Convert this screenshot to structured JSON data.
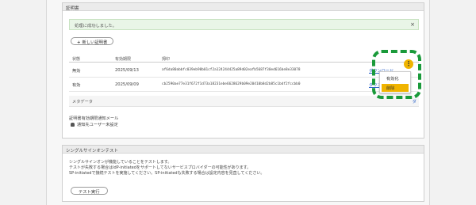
{
  "certificates": {
    "panel_title": "証明書",
    "alert_message": "処理に成功しました。",
    "alert_close": "×",
    "new_cert_button": "新しい証明書",
    "new_cert_plus": "+",
    "columns": [
      "状態",
      "有効期限",
      "拇印"
    ],
    "rows": [
      {
        "status": "無効",
        "expiry": "2025/09/13",
        "thumbprint": "af6da80abbfc039eb90b01cf2a124244425a89d02eafb5687f30ed616be8e33078",
        "action": "ダウンロード"
      },
      {
        "status": "有効",
        "expiry": "2025/09/09",
        "thumbprint": "cb2590ae77e31f672f1d73a18231ebe6628629b09e20410b8d2b85c1bdf2fccbb0",
        "action": "ダウンロード"
      }
    ],
    "menu_icon": "⋮",
    "menu_items": [
      "有効化",
      "削除"
    ],
    "metadata_label": "メタデータ",
    "metadata_link": "ダ",
    "expiry_notice_title": "証明書有効期限通知メール",
    "notify_setting": "通知先ユーザー未設定"
  },
  "sso_test": {
    "panel_title": "シングルサインオンテスト",
    "lines": [
      "シングルサインオンが機能していることをテストします。",
      "テストが失敗する場合はIdP-initiatedをサポートしてないサービスプロバイダーの可能性があります。",
      "SP-initiatedで接続テストを実施してください。SP-initiatedも失敗する場合は設定内容を見直してください。"
    ],
    "run_button": "テスト実行"
  },
  "colors": {
    "accent_yellow": "#f0b400",
    "highlight_green": "#1a9a3a",
    "link_blue": "#2a62c8",
    "success_bg": "#e9f5e7"
  },
  "icons": [
    "close-icon",
    "plus-icon",
    "kebab-menu-icon",
    "bell-icon"
  ]
}
